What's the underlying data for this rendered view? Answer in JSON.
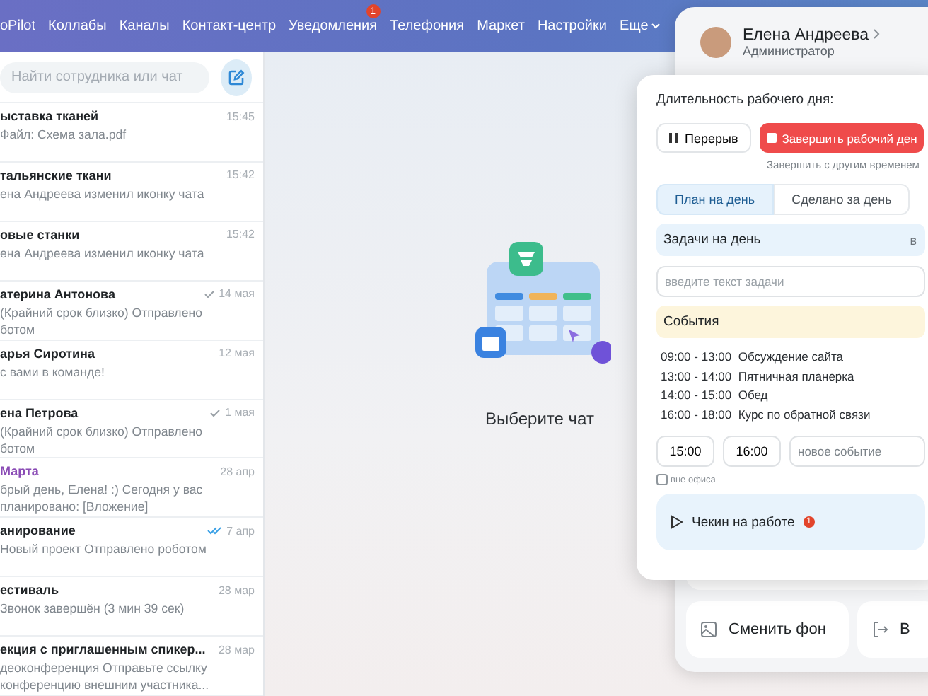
{
  "top_nav": {
    "items": [
      {
        "label": "oPilot"
      },
      {
        "label": "Коллабы"
      },
      {
        "label": "Каналы"
      },
      {
        "label": "Контакт-центр"
      },
      {
        "label": "Уведомления",
        "badge": "1"
      },
      {
        "label": "Телефония"
      },
      {
        "label": "Маркет"
      },
      {
        "label": "Настройки"
      },
      {
        "label": "Еще"
      }
    ]
  },
  "sidebar": {
    "search": {
      "placeholder": "Найти сотрудника или чат"
    },
    "chats": [
      {
        "name": "ыставка тканей",
        "preview": "Файл: Схема зала.pdf",
        "time": "15:45",
        "delivered": false,
        "read": false,
        "accent": false
      },
      {
        "name": "тальянские ткани",
        "preview": "ена Андреева изменил иконку чата",
        "time": "15:42",
        "delivered": false,
        "read": false,
        "accent": false
      },
      {
        "name": "овые станки",
        "preview": "ена Андреева изменил иконку чата",
        "time": "15:42",
        "delivered": false,
        "read": false,
        "accent": false
      },
      {
        "name": "атерина Антонова",
        "preview": "(Крайний срок близко) Отправлено ботом",
        "time": "14 мая",
        "delivered": true,
        "read": false,
        "accent": false
      },
      {
        "name": "арья Сиротина",
        "preview": "с вами в команде!",
        "time": "12 мая",
        "delivered": false,
        "read": false,
        "accent": false
      },
      {
        "name": "ена Петрова",
        "preview": "(Крайний срок близко) Отправлено ботом",
        "time": "1 мая",
        "delivered": true,
        "read": false,
        "accent": false
      },
      {
        "name": "Марта",
        "preview": "брый день, Елена! :) Сегодня у вас планировано: [Вложение]",
        "time": "28 апр",
        "delivered": false,
        "read": false,
        "accent": true
      },
      {
        "name": "анирование",
        "preview": "Новый проект Отправлено роботом",
        "time": "7 апр",
        "delivered": true,
        "read": true,
        "accent": false
      },
      {
        "name": "естиваль",
        "preview": "Звонок завершён (3 мин 39 сек)",
        "time": "28 мар",
        "delivered": false,
        "read": false,
        "accent": false
      },
      {
        "name": "екция с приглашенным спикер...",
        "preview": "деоконференция Отправьте ссылку конференцию внешним участника...",
        "time": "28 мар",
        "delivered": false,
        "read": false,
        "accent": false
      }
    ]
  },
  "empty_state": {
    "text": "Выберите чат"
  },
  "profile_panel": {
    "name": "Елена Андреева",
    "role": "Администратор",
    "buttons": [
      "Сменить фон",
      "В"
    ]
  },
  "workday_popup": {
    "title": "Длительность рабочего дня:",
    "pause_button": "Перерыв",
    "finish_button": "Завершить рабочий ден",
    "finish_other_link": "Завершить с другим временем",
    "tabs": [
      {
        "label": "План на день",
        "selected": true
      },
      {
        "label": "Сделано за день",
        "selected": false
      }
    ],
    "tasks": {
      "title": "Задачи на день",
      "side_text": "в",
      "input_placeholder": "введите текст задачи"
    },
    "events": {
      "title": "События",
      "items": [
        {
          "time": "09:00 - 13:00",
          "title": "Обсуждение сайта"
        },
        {
          "time": "13:00 - 14:00",
          "title": "Пятничная планерка"
        },
        {
          "time": "14:00 - 15:00",
          "title": "Обед"
        },
        {
          "time": "16:00 - 18:00",
          "title": "Курс по обратной связи"
        }
      ],
      "start": "15:00",
      "end": "16:00",
      "new_placeholder": "новое событие",
      "out_of_office": {
        "label": "вне офиса",
        "checked": false
      }
    },
    "checkin": {
      "label": "Чекин на работе",
      "badge": "1"
    }
  }
}
